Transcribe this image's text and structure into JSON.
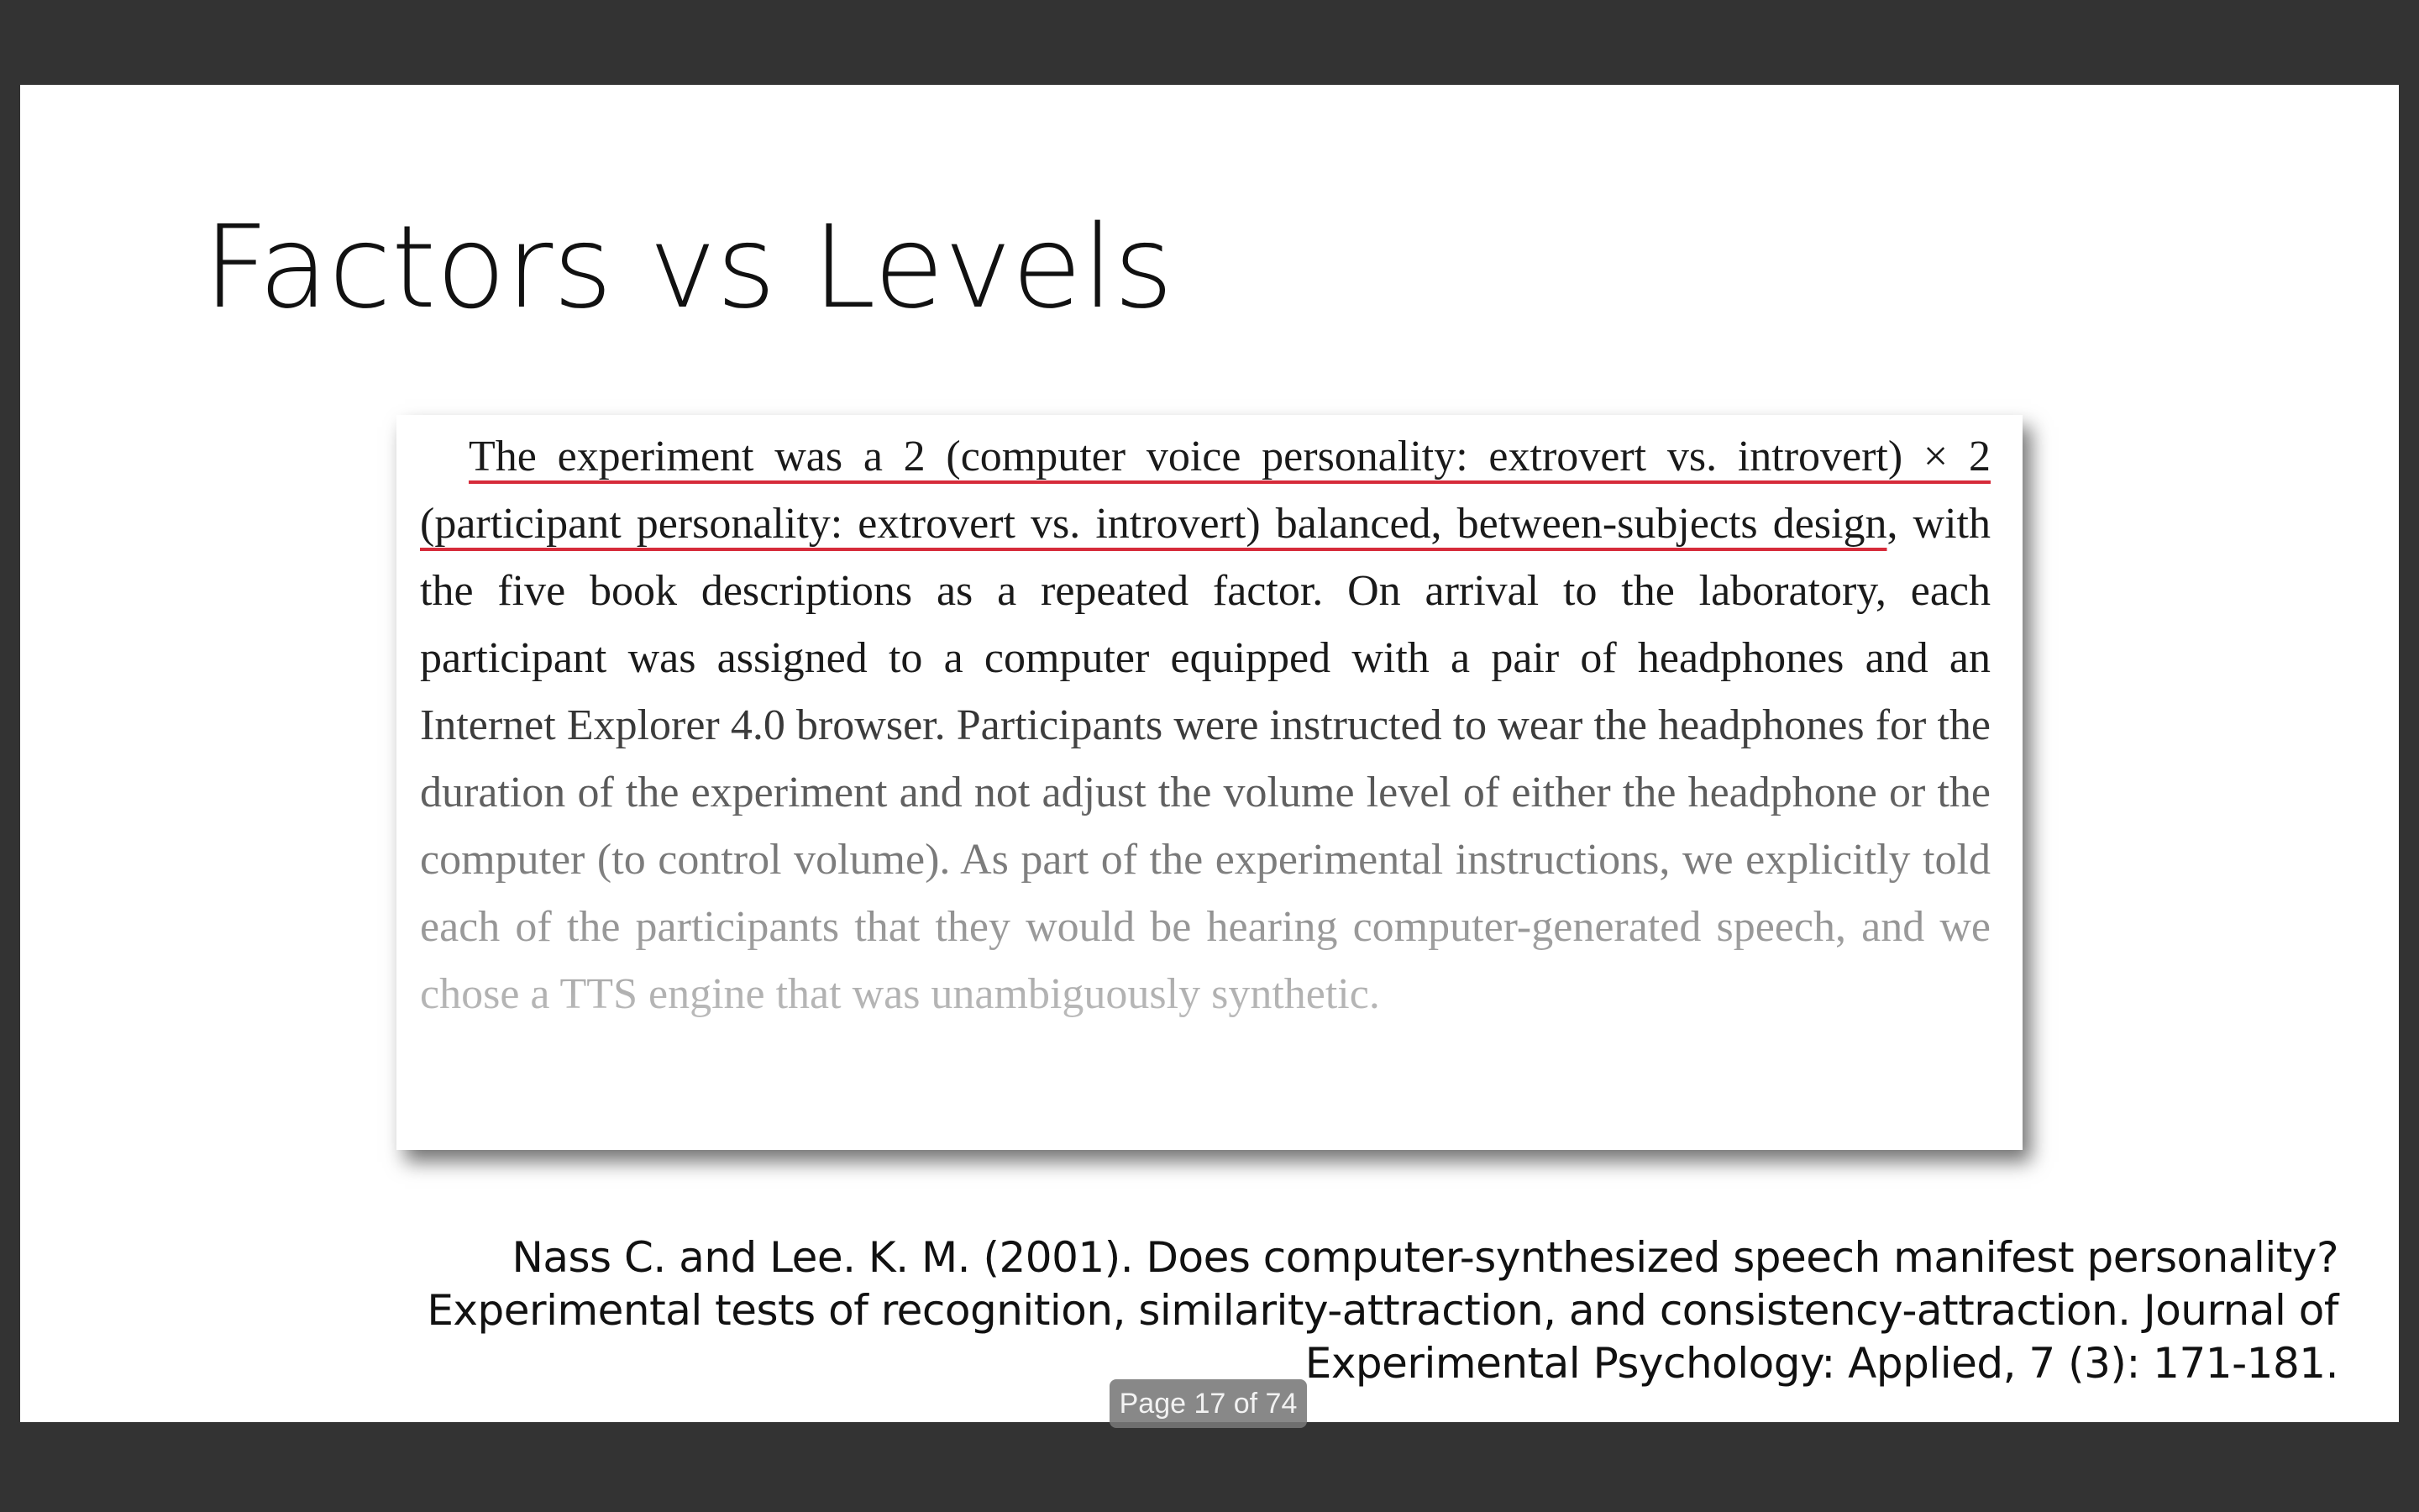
{
  "slide": {
    "title": "Factors vs Levels",
    "excerpt": {
      "underlined_text": "The experiment was a 2 (computer voice personality: extrovert vs. introvert) × 2 (participant personality: extrovert vs. introvert) balanced, between-subjects design",
      "body_text": ", with the five book descriptions as a repeated factor. On arrival to the laboratory, each participant was assigned to a computer equipped with a pair of headphones and an Internet Explorer 4.0 browser. Participants were instructed to wear the headphones for the duration of the experiment and not adjust the volume level of either the headphone or the computer (to control volume). As part of the experimental instructions, we explicitly told each of the participants that they would be hearing computer-generated speech, and we chose a TTS engine that was unambiguously synthetic.",
      "underline_color": "#d62b3a"
    },
    "citation": "Nass C. and Lee. K. M. (2001). Does computer-synthesized speech manifest personality? Experimental tests of recognition, similarity-attraction, and consistency-attraction. Journal of Experimental Psychology: Applied, 7 (3): 171-181."
  },
  "viewer": {
    "page_indicator": "Page 17 of 74",
    "background_color": "#333333"
  }
}
